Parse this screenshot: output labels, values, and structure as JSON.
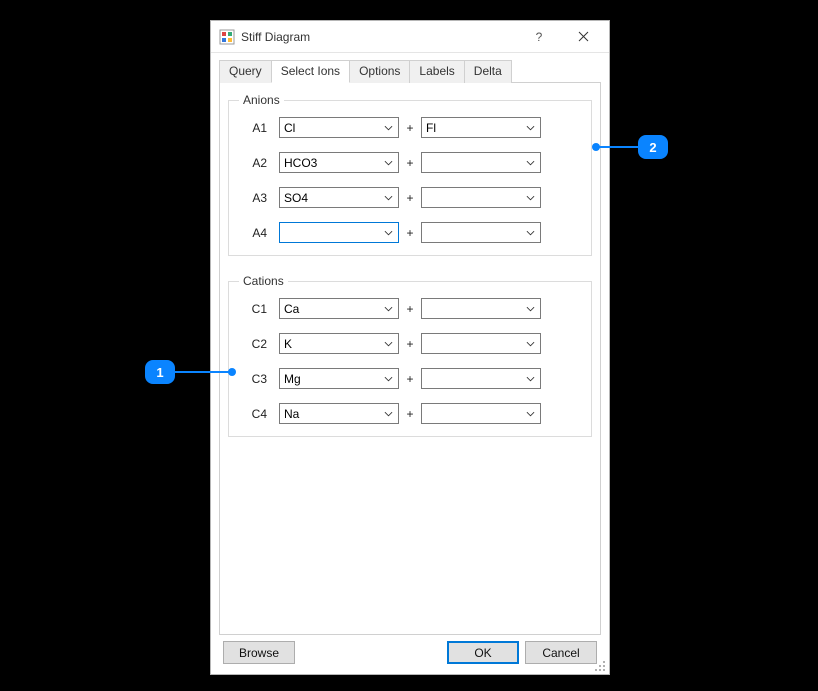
{
  "window": {
    "title": "Stiff Diagram",
    "help_symbol": "?",
    "close_symbol": "×"
  },
  "tabs": [
    "Query",
    "Select Ions",
    "Options",
    "Labels",
    "Delta"
  ],
  "active_tab": "Select Ions",
  "groups": {
    "anions": {
      "legend": "Anions",
      "rows": [
        {
          "label": "A1",
          "left": "Cl",
          "right": "Fl"
        },
        {
          "label": "A2",
          "left": "HCO3",
          "right": ""
        },
        {
          "label": "A3",
          "left": "SO4",
          "right": ""
        },
        {
          "label": "A4",
          "left": "",
          "right": "",
          "focused": true
        }
      ]
    },
    "cations": {
      "legend": "Cations",
      "rows": [
        {
          "label": "C1",
          "left": "Ca",
          "right": ""
        },
        {
          "label": "C2",
          "left": "K",
          "right": ""
        },
        {
          "label": "C3",
          "left": "Mg",
          "right": ""
        },
        {
          "label": "C4",
          "left": "Na",
          "right": ""
        }
      ]
    }
  },
  "plus_label": "+",
  "buttons": {
    "browse": "Browse",
    "ok": "OK",
    "cancel": "Cancel"
  },
  "callouts": {
    "one": "1",
    "two": "2"
  }
}
